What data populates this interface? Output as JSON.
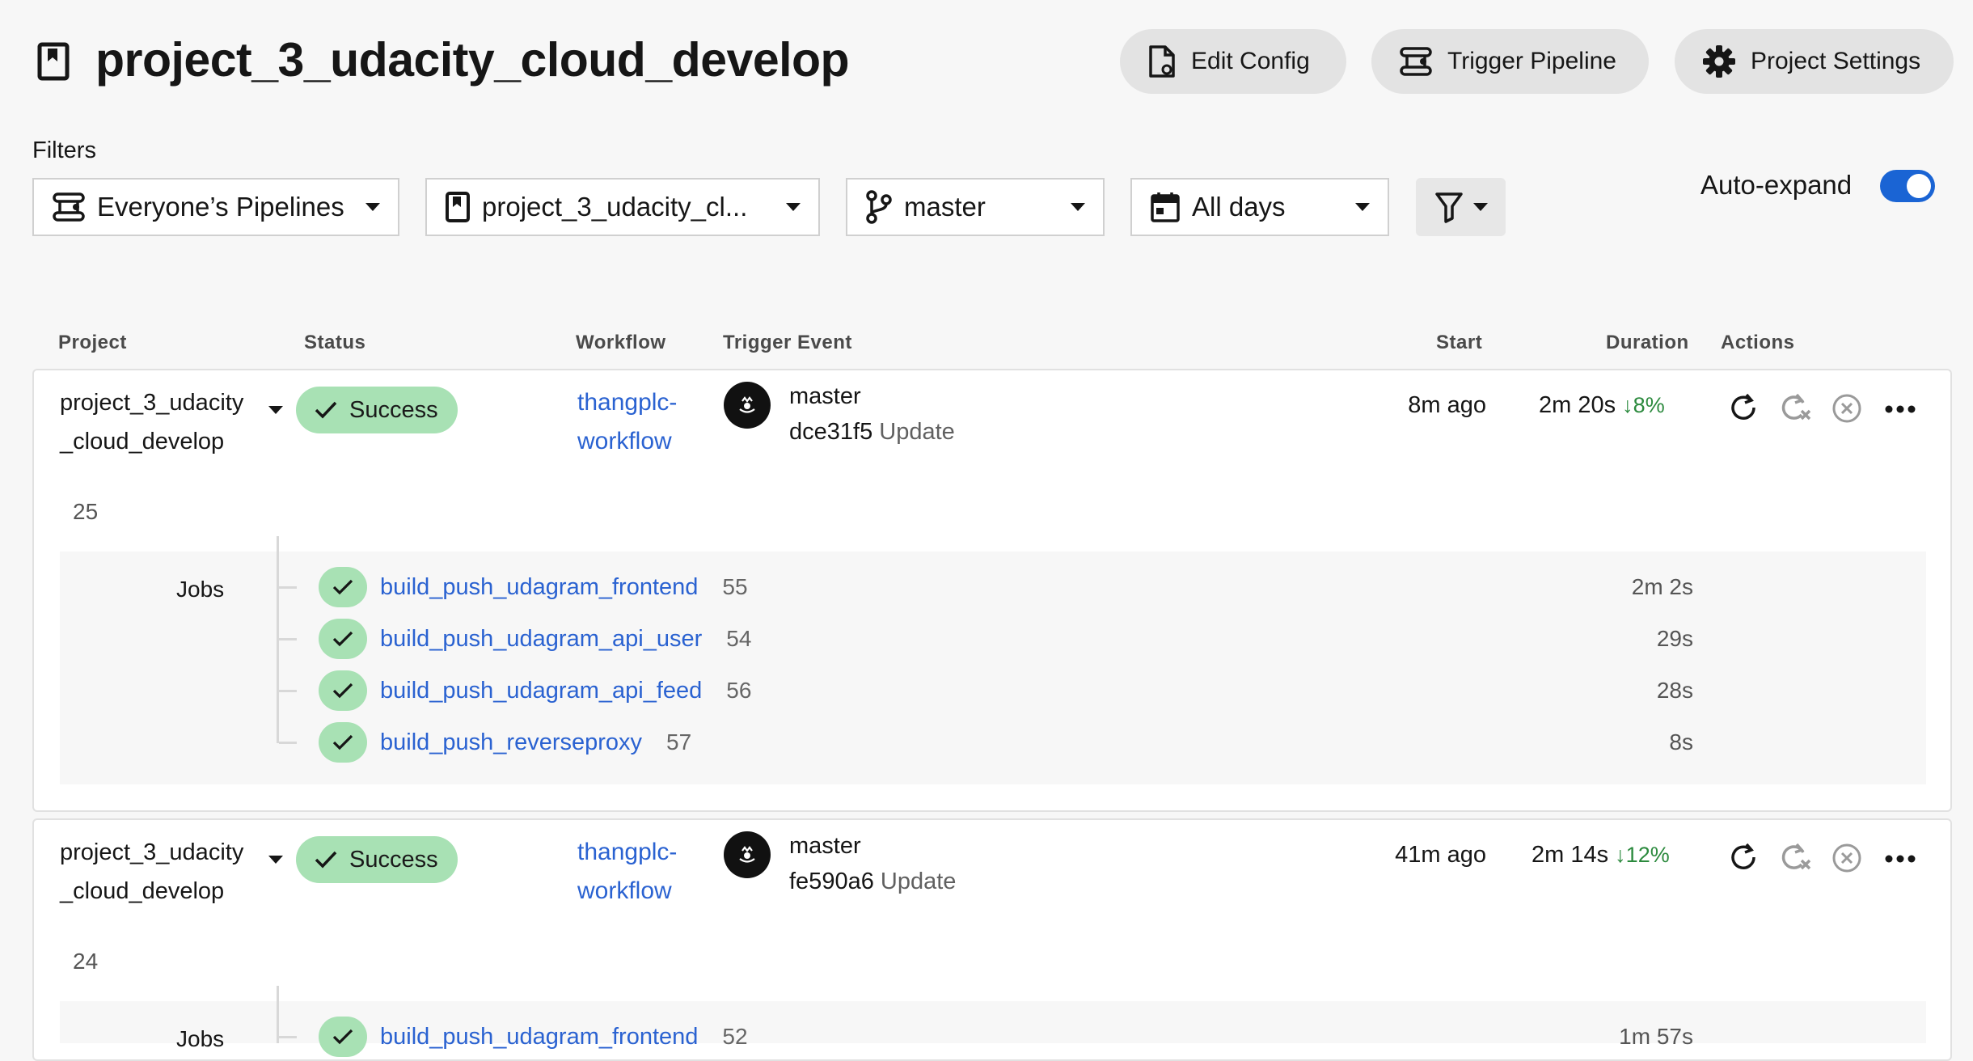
{
  "header": {
    "title": "project_3_udacity_cloud_develop",
    "edit_config": "Edit Config",
    "trigger_pipeline": "Trigger Pipeline",
    "project_settings": "Project Settings"
  },
  "filters": {
    "label": "Filters",
    "pipelines": "Everyone’s Pipelines",
    "project": "project_3_udacity_cl...",
    "branch": "master",
    "days": "All days",
    "auto_expand": "Auto-expand",
    "auto_expand_on": true
  },
  "columns": {
    "project": "Project",
    "status": "Status",
    "workflow": "Workflow",
    "trigger": "Trigger Event",
    "start": "Start",
    "duration": "Duration",
    "actions": "Actions"
  },
  "pipelines": [
    {
      "project": "project_3_udacity_cloud_develop",
      "number": "25",
      "status": "Success",
      "workflow": "thangplc-workflow",
      "branch": "master",
      "commit": "dce31f5",
      "commit_msg": "Update",
      "start": "8m ago",
      "duration": "2m 20s",
      "delta": "8%",
      "jobs_label": "Jobs",
      "jobs": [
        {
          "name": "build_push_udagram_frontend",
          "number": "55",
          "duration": "2m 2s"
        },
        {
          "name": "build_push_udagram_api_user",
          "number": "54",
          "duration": "29s"
        },
        {
          "name": "build_push_udagram_api_feed",
          "number": "56",
          "duration": "28s"
        },
        {
          "name": "build_push_reverseproxy",
          "number": "57",
          "duration": "8s"
        }
      ]
    },
    {
      "project": "project_3_udacity_cloud_develop",
      "number": "24",
      "status": "Success",
      "workflow": "thangplc-workflow",
      "branch": "master",
      "commit": "fe590a6",
      "commit_msg": "Update",
      "start": "41m ago",
      "duration": "2m 14s",
      "delta": "12%",
      "jobs_label": "Jobs",
      "jobs": [
        {
          "name": "build_push_udagram_frontend",
          "number": "52",
          "duration": "1m 57s"
        }
      ]
    }
  ],
  "colors": {
    "accent": "#1a64d4",
    "link": "#2a62d1",
    "success_bg": "#a8e1b4",
    "success_text": "#2c8a3e"
  }
}
